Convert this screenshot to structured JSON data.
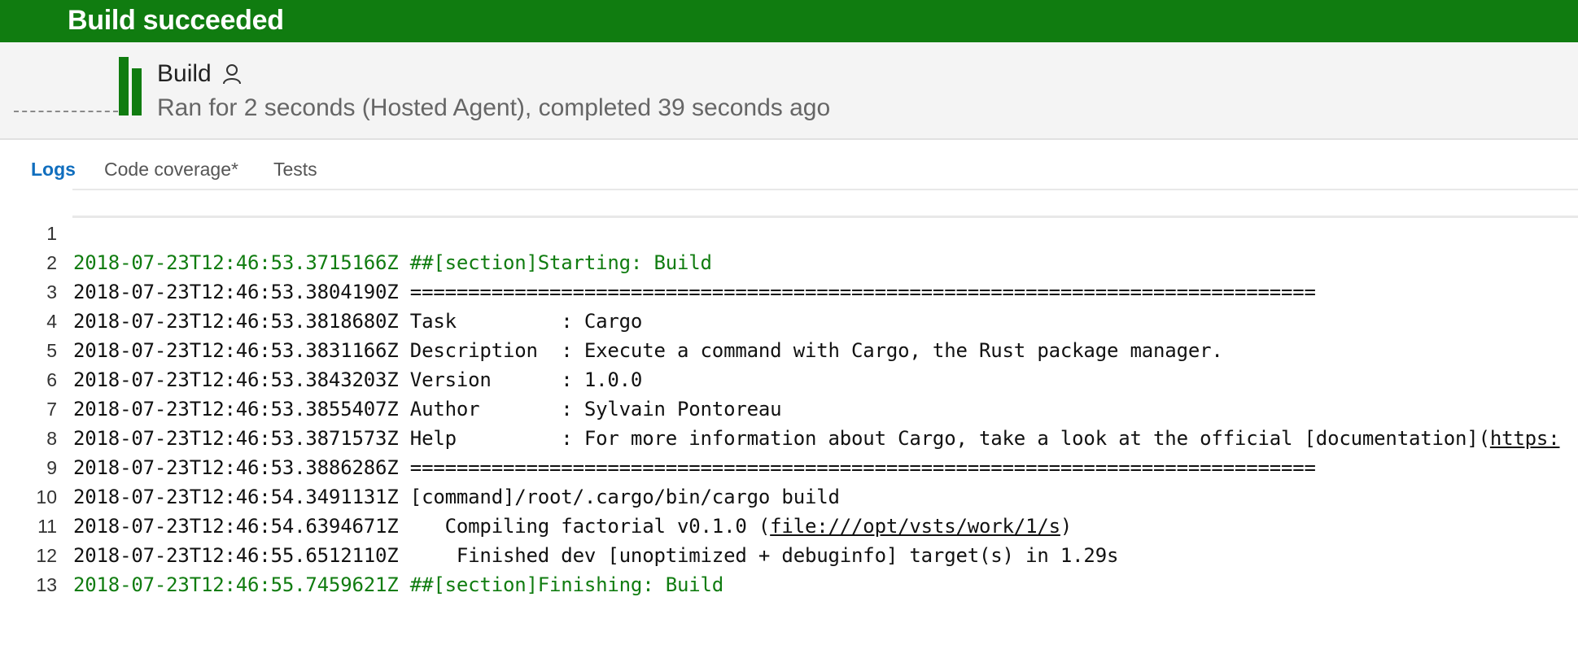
{
  "banner": {
    "title": "Build succeeded",
    "color": "#107c10"
  },
  "summary": {
    "title": "Build",
    "subtitle": "Ran for 2 seconds (Hosted Agent), completed 39 seconds ago",
    "person_icon": "person-icon"
  },
  "tabs": [
    {
      "label": "Logs",
      "active": true
    },
    {
      "label": "Code coverage*",
      "active": false
    },
    {
      "label": "Tests",
      "active": false
    }
  ],
  "log": {
    "lines": [
      {
        "num": "1",
        "text": "2018-07-23T12:46:53.3715166Z ##[section]Starting: Build",
        "style": "section"
      },
      {
        "num": "2",
        "text": "2018-07-23T12:46:53.3804190Z ==============================================================================",
        "style": "normal"
      },
      {
        "num": "3",
        "text": "2018-07-23T12:46:53.3818680Z Task         : Cargo",
        "style": "normal"
      },
      {
        "num": "4",
        "text": "2018-07-23T12:46:53.3831166Z Description  : Execute a command with Cargo, the Rust package manager.",
        "style": "normal"
      },
      {
        "num": "5",
        "text": "2018-07-23T12:46:53.3843203Z Version      : 1.0.0",
        "style": "normal"
      },
      {
        "num": "6",
        "text": "2018-07-23T12:46:53.3855407Z Author       : Sylvain Pontoreau",
        "style": "normal"
      },
      {
        "num": "7",
        "text_before": "2018-07-23T12:46:53.3871573Z Help         : For more information about Cargo, take a look at the official [documentation](",
        "link": "https:",
        "style": "normal"
      },
      {
        "num": "8",
        "text": "2018-07-23T12:46:53.3886286Z ==============================================================================",
        "style": "normal"
      },
      {
        "num": "9",
        "text": "2018-07-23T12:46:54.3491131Z [command]/root/.cargo/bin/cargo build",
        "style": "normal"
      },
      {
        "num": "10",
        "text_before": "2018-07-23T12:46:54.6394671Z    Compiling factorial v0.1.0 (",
        "link": "file:///opt/vsts/work/1/s",
        "text_after": ")",
        "style": "normal"
      },
      {
        "num": "11",
        "text": "2018-07-23T12:46:55.6512110Z     Finished dev [unoptimized + debuginfo] target(s) in 1.29s",
        "style": "normal"
      },
      {
        "num": "12",
        "text": "2018-07-23T12:46:55.7459621Z ##[section]Finishing: Build",
        "style": "section"
      },
      {
        "num": "13",
        "text": "",
        "style": "normal"
      }
    ]
  }
}
